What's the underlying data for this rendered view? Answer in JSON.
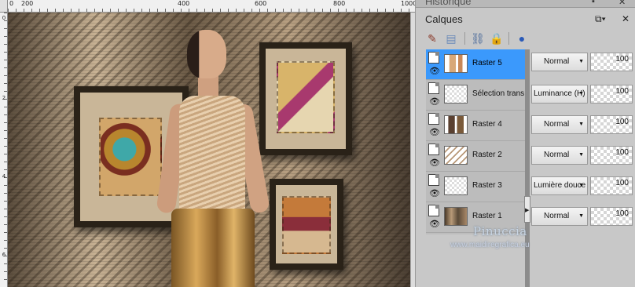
{
  "window": {
    "top_panel_title": "Historique"
  },
  "ruler": {
    "top_labels": [
      "0",
      "200",
      "400",
      "600",
      "800",
      "1000"
    ],
    "left_labels": [
      "0",
      "2",
      "4",
      "6"
    ]
  },
  "layers_panel": {
    "title": "Calques",
    "title_buttons": [
      "restore-icon",
      "close-icon"
    ],
    "toolbar_icons": [
      "new-raster-layer-icon",
      "new-mask-layer-icon",
      "link-icon",
      "lock-icon",
      "layer-properties-icon"
    ],
    "layers": [
      {
        "name": "Raster 5",
        "selected": true,
        "thumb": "raster5",
        "blend_mode": "Normal",
        "opacity": "100"
      },
      {
        "name": "Sélection transfo",
        "selected": false,
        "thumb": "selection",
        "blend_mode": "Luminance (H)",
        "opacity": "100"
      },
      {
        "name": "Raster 4",
        "selected": false,
        "thumb": "raster4",
        "blend_mode": "Normal",
        "opacity": "100"
      },
      {
        "name": "Raster 2",
        "selected": false,
        "thumb": "raster2",
        "blend_mode": "Normal",
        "opacity": "100"
      },
      {
        "name": "Raster 3",
        "selected": false,
        "thumb": "selection",
        "blend_mode": "Lumière douce",
        "opacity": "100"
      },
      {
        "name": "Raster 1",
        "selected": false,
        "thumb": "raster1",
        "blend_mode": "Normal",
        "opacity": "100"
      }
    ]
  },
  "watermark": {
    "name": "Pinuccia",
    "url": "www.maidiregrafica.eu"
  },
  "colors": {
    "selected_layer": "#3b99fc",
    "panel_bg": "#c8c8c8"
  }
}
